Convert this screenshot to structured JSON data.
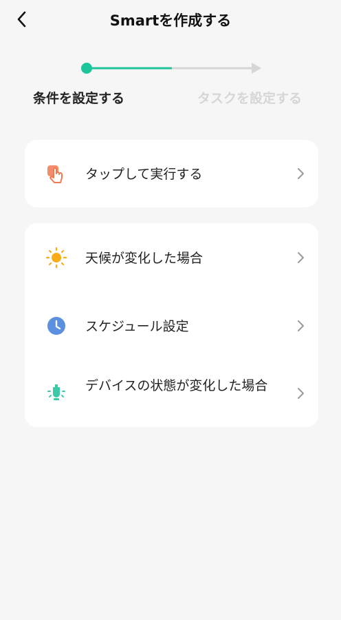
{
  "header": {
    "title": "Smartを作成する"
  },
  "stepper": {
    "steps": [
      {
        "label": "条件を設定する",
        "active": true
      },
      {
        "label": "タスクを設定する",
        "active": false
      }
    ],
    "colors": {
      "active": "#1fc59a",
      "inactive": "#d6d6d6"
    }
  },
  "cards": [
    {
      "items": [
        {
          "label": "タップして実行する",
          "icon": "tap-hand-icon",
          "color": "#f07a52"
        }
      ]
    },
    {
      "items": [
        {
          "label": "天候が変化した場合",
          "icon": "sun-icon",
          "color": "#f8ac17"
        },
        {
          "label": "スケジュール設定",
          "icon": "clock-icon",
          "color": "#5b8fe0"
        },
        {
          "label": "デバイスの状態が変化した場合",
          "icon": "device-bulb-icon",
          "color": "#3ccba8"
        }
      ]
    }
  ]
}
